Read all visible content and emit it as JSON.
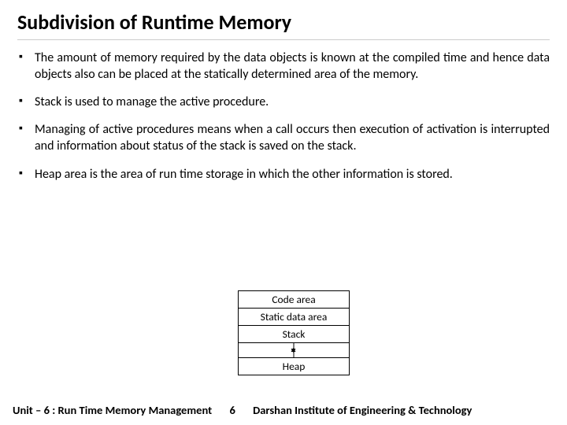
{
  "title": "Subdivision of Runtime Memory",
  "bullets": [
    "The amount of memory required by the data objects is known at the compiled time and hence data objects also can be placed at the statically determined area of the memory.",
    "Stack is used to manage the active procedure.",
    "Managing of active procedures means when a call occurs then execution of activation is interrupted and information about status of the stack is saved on the stack.",
    "Heap area is the area of run time storage in which the other information is stored."
  ],
  "diagram": {
    "rows": [
      "Code area",
      "Static data area",
      "Stack",
      "Heap"
    ]
  },
  "footer": {
    "left": "Unit – 6 : Run Time Memory Management",
    "page": "6",
    "right": "Darshan Institute of Engineering & Technology"
  }
}
